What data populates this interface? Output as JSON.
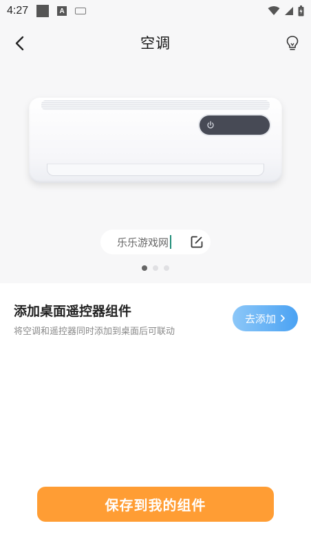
{
  "status_bar": {
    "time": "4:27",
    "icons": [
      "gallery-icon",
      "a-icon",
      "keyboard-icon",
      "wifi-icon",
      "signal-icon",
      "battery-icon"
    ]
  },
  "header": {
    "title": "空调",
    "back_icon": "chevron-left-icon",
    "help_icon": "lightbulb-icon"
  },
  "device": {
    "name": "乐乐游戏网",
    "edit_icon": "edit-icon",
    "power_icon": "power-icon",
    "page_count": 3,
    "active_page": 1
  },
  "widget": {
    "title": "添加桌面遥控器组件",
    "subtitle": "将空调和遥控器同时添加到桌面后可联动",
    "add_label": "去添加",
    "add_icon": "chevron-right-icon"
  },
  "footer": {
    "save_label": "保存到我的组件"
  },
  "colors": {
    "accent_orange": "#ff9d34",
    "accent_blue": "#4aa2f3",
    "caret_green": "#1e8c78",
    "hero_bg": "#f7f7f8"
  }
}
